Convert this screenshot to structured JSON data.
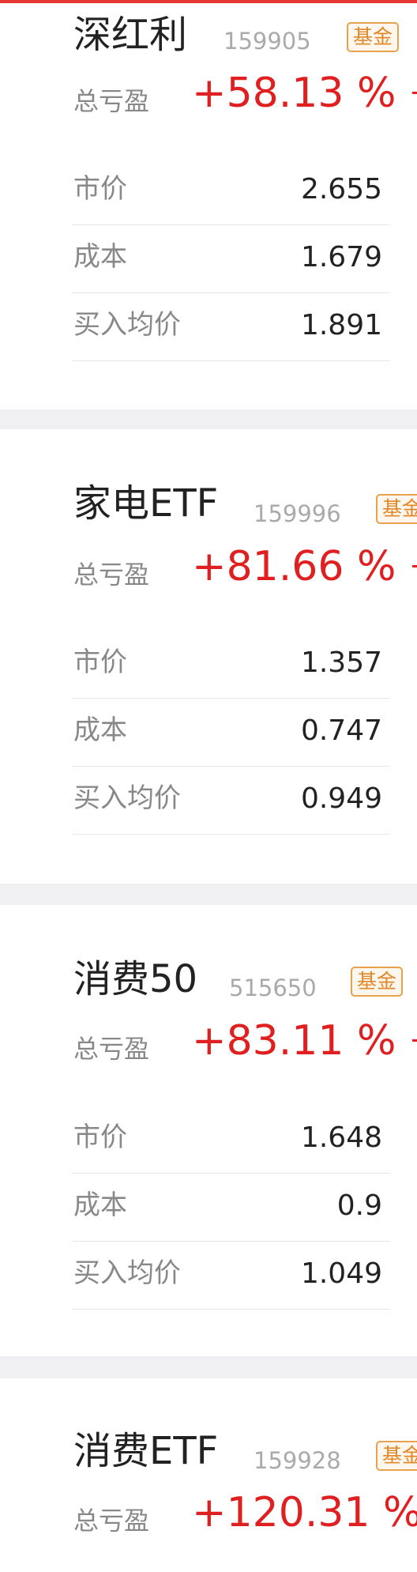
{
  "colors": {
    "profit_red": "#e02020",
    "badge_orange": "#e0892a",
    "label_gray": "#888888"
  },
  "funds": [
    {
      "name": "深红利",
      "code": "159905",
      "badge": "基金",
      "pl_label": "总亏盈",
      "pl_value": "+58.13 %",
      "rows": [
        {
          "label": "市价",
          "value": "2.655"
        },
        {
          "label": "成本",
          "value": "1.679"
        },
        {
          "label": "买入均价",
          "value": "1.891"
        }
      ]
    },
    {
      "name": "家电ETF",
      "code": "159996",
      "badge": "基金",
      "pl_label": "总亏盈",
      "pl_value": "+81.66 %",
      "rows": [
        {
          "label": "市价",
          "value": "1.357"
        },
        {
          "label": "成本",
          "value": "0.747"
        },
        {
          "label": "买入均价",
          "value": "0.949"
        }
      ]
    },
    {
      "name": "消费50",
      "code": "515650",
      "badge": "基金",
      "pl_label": "总亏盈",
      "pl_value": "+83.11 %",
      "rows": [
        {
          "label": "市价",
          "value": "1.648"
        },
        {
          "label": "成本",
          "value": "0.9"
        },
        {
          "label": "买入均价",
          "value": "1.049"
        }
      ]
    },
    {
      "name": "消费ETF",
      "code": "159928",
      "badge": "基金",
      "pl_label": "总亏盈",
      "pl_value": "+120.31 %"
    }
  ]
}
